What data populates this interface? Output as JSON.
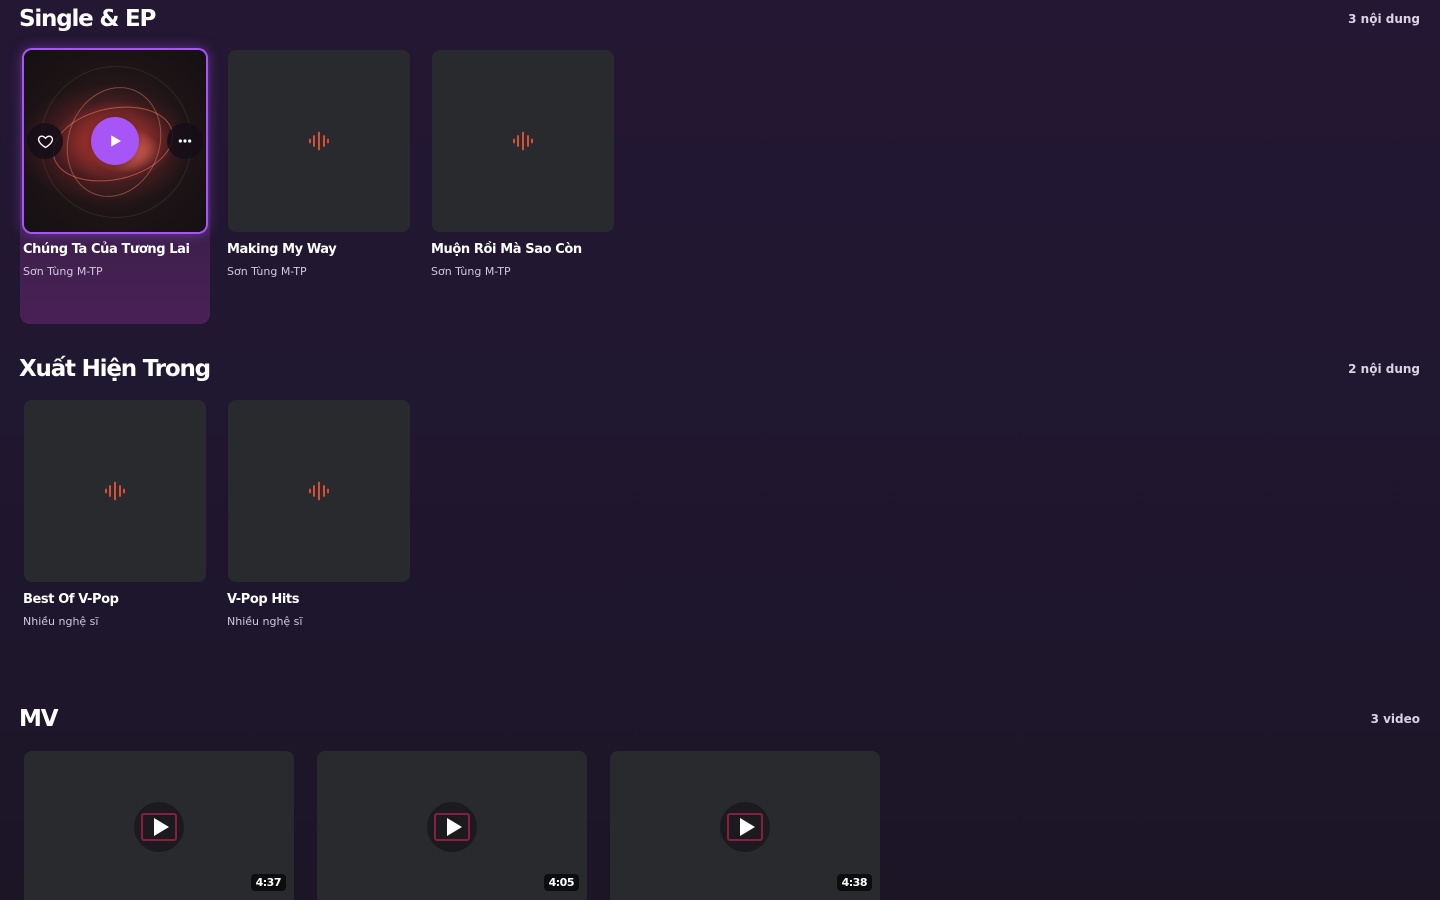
{
  "sections": {
    "singles": {
      "title": "Single & EP",
      "count": "3 nội dung",
      "items": [
        {
          "title": "Chúng Ta Của Tương Lai",
          "subtitle": "Sơn Tùng M-TP"
        },
        {
          "title": "Making My Way",
          "subtitle": "Sơn Tùng M-TP"
        },
        {
          "title": "Muộn Rồi Mà Sao Còn",
          "subtitle": "Sơn Tùng M-TP"
        }
      ]
    },
    "appears_in": {
      "title": "Xuất Hiện Trong",
      "count": "2 nội dung",
      "items": [
        {
          "title": "Best Of V-Pop",
          "subtitle": "Nhiều nghệ sĩ"
        },
        {
          "title": "V-Pop Hits",
          "subtitle": "Nhiều nghệ sĩ"
        }
      ]
    },
    "mv": {
      "title": "MV",
      "count": "3 video",
      "items": [
        {
          "duration": "4:37"
        },
        {
          "duration": "4:05"
        },
        {
          "duration": "4:38"
        }
      ]
    }
  },
  "colors": {
    "accent": "#a855f7",
    "placeholder_icon": "#e8553a",
    "card_bg": "#292a2d",
    "page_bg": "#201730"
  },
  "icons": {
    "placeholder": "audio-wave-icon",
    "favorite": "heart-outline-icon",
    "more": "more-horizontal-icon",
    "play": "play-icon"
  }
}
